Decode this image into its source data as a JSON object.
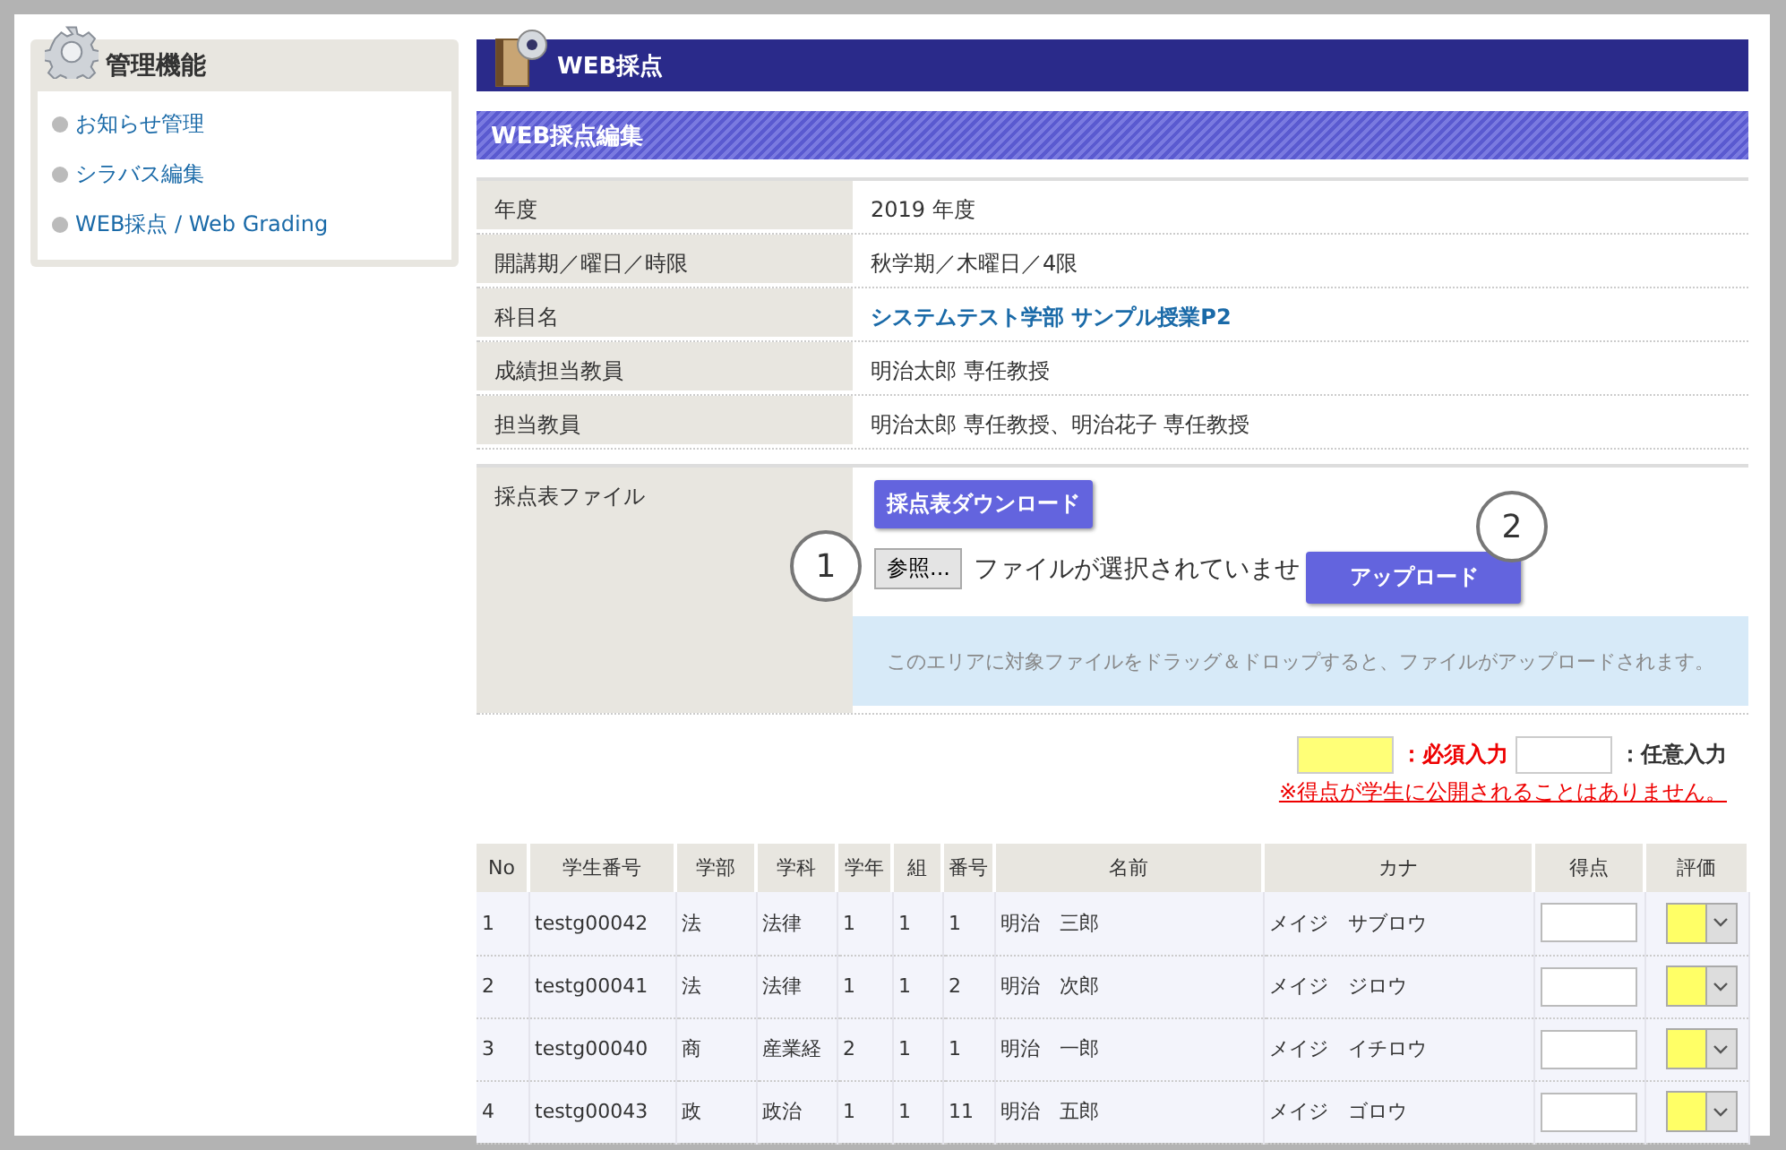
{
  "sidebar": {
    "title": "管理機能",
    "items": [
      {
        "label": "お知らせ管理"
      },
      {
        "label": "シラバス編集"
      },
      {
        "label": "WEB採点 / Web Grading"
      }
    ]
  },
  "page_header": {
    "title": "WEB採点"
  },
  "section_header": {
    "title": "WEB採点編集"
  },
  "info": [
    {
      "label": "年度",
      "value": "2019 年度",
      "kind": "text"
    },
    {
      "label": "開講期／曜日／時限",
      "value": "秋学期／木曜日／4限",
      "kind": "text"
    },
    {
      "label": "科目名",
      "value": "システムテスト学部 サンプル授業P2",
      "kind": "link"
    },
    {
      "label": "成績担当教員",
      "value": "明治太郎 専任教授",
      "kind": "text"
    },
    {
      "label": "担当教員",
      "value": "明治太郎 専任教授、明治花子 専任教授",
      "kind": "text"
    }
  ],
  "file_section": {
    "label": "採点表ファイル",
    "download_button": "採点表ダウンロード",
    "browse_button": "参照...",
    "file_status": "ファイルが選択されていませ",
    "upload_button": "アップロード",
    "drop_hint": "このエリアに対象ファイルをドラッグ＆ドロップすると、ファイルがアップロードされます。"
  },
  "callouts": [
    "1",
    "2"
  ],
  "legend": {
    "required": "：必須入力",
    "optional": "：任意入力",
    "notice": "※得点が学生に公開されることはありません。"
  },
  "table": {
    "columns": [
      "No",
      "学生番号",
      "学部",
      "学科",
      "学年",
      "組",
      "番号",
      "名前",
      "カナ",
      "得点",
      "評価"
    ],
    "rows": [
      {
        "cells": [
          "1",
          "testg00042",
          "法",
          "法律",
          "1",
          "1",
          "1",
          "明治　三郎",
          "メイジ　サブロウ"
        ],
        "grade_required": true
      },
      {
        "cells": [
          "2",
          "testg00041",
          "法",
          "法律",
          "1",
          "1",
          "2",
          "明治　次郎",
          "メイジ　ジロウ"
        ],
        "grade_required": true
      },
      {
        "cells": [
          "3",
          "testg00040",
          "商",
          "産業経",
          "2",
          "1",
          "1",
          "明治　一郎",
          "メイジ　イチロウ"
        ],
        "grade_required": true
      },
      {
        "cells": [
          "4",
          "testg00043",
          "政",
          "政治",
          "1",
          "1",
          "11",
          "明治　五郎",
          "メイジ　ゴロウ"
        ],
        "grade_required": true
      }
    ]
  }
}
